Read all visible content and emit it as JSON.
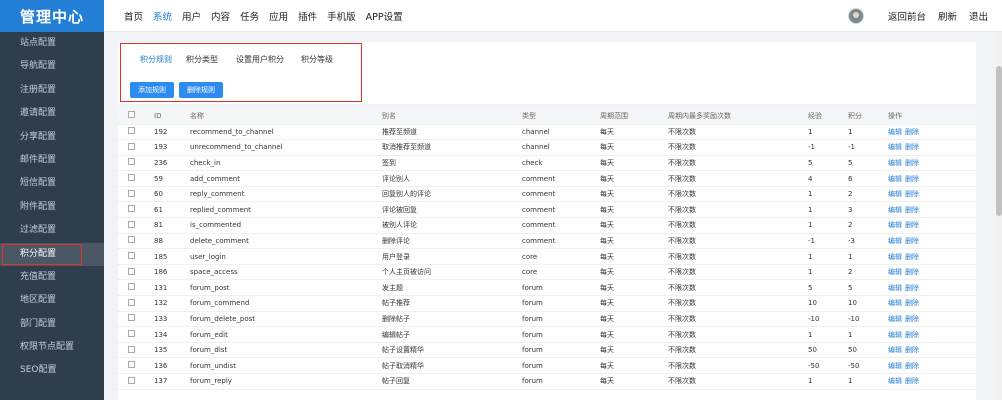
{
  "brand": "管理中心",
  "sidebar": {
    "items": [
      "站点配置",
      "导航配置",
      "注册配置",
      "邀请配置",
      "分享配置",
      "邮件配置",
      "短信配置",
      "附件配置",
      "过滤配置",
      "积分配置",
      "充值配置",
      "地区配置",
      "部门配置",
      "权限节点配置",
      "SEO配置"
    ],
    "active_index": 9
  },
  "topnav": {
    "items": [
      "首页",
      "系统",
      "用户",
      "内容",
      "任务",
      "应用",
      "插件",
      "手机版",
      "APP设置"
    ],
    "active_index": 1
  },
  "topright": [
    "返回前台",
    "刷新",
    "退出"
  ],
  "tabs": [
    "积分规则",
    "积分类型",
    "设置用户积分",
    "积分等级"
  ],
  "buttons": [
    "添加规则",
    "删除规则"
  ],
  "table": {
    "headers": [
      "ID",
      "名称",
      "别名",
      "类型",
      "周期范围",
      "周期内最多奖励次数",
      "经验",
      "积分",
      "操作"
    ],
    "op_labels": [
      "编辑",
      "删除"
    ],
    "rows": [
      [
        "192",
        "recommend_to_channel",
        "推荐至频道",
        "channel",
        "每天",
        "不限次数",
        "1",
        "1"
      ],
      [
        "193",
        "unrecommend_to_channel",
        "取消推荐至频道",
        "channel",
        "每天",
        "不限次数",
        "-1",
        "-1"
      ],
      [
        "236",
        "check_in",
        "签到",
        "check",
        "每天",
        "不限次数",
        "5",
        "5"
      ],
      [
        "59",
        "add_comment",
        "评论别人",
        "comment",
        "每天",
        "不限次数",
        "4",
        "6"
      ],
      [
        "60",
        "reply_comment",
        "回复别人的评论",
        "comment",
        "每天",
        "不限次数",
        "1",
        "2"
      ],
      [
        "61",
        "replied_comment",
        "评论被回复",
        "comment",
        "每天",
        "不限次数",
        "1",
        "3"
      ],
      [
        "81",
        "is_commented",
        "被别人评论",
        "comment",
        "每天",
        "不限次数",
        "1",
        "2"
      ],
      [
        "88",
        "delete_comment",
        "删除评论",
        "comment",
        "每天",
        "不限次数",
        "-1",
        "-3"
      ],
      [
        "185",
        "user_login",
        "用户登录",
        "core",
        "每天",
        "不限次数",
        "1",
        "1"
      ],
      [
        "186",
        "space_access",
        "个人主页被访问",
        "core",
        "每天",
        "不限次数",
        "1",
        "2"
      ],
      [
        "131",
        "forum_post",
        "发主题",
        "forum",
        "每天",
        "不限次数",
        "5",
        "5"
      ],
      [
        "132",
        "forum_commend",
        "帖子推荐",
        "forum",
        "每天",
        "不限次数",
        "10",
        "10"
      ],
      [
        "133",
        "forum_delete_post",
        "删除帖子",
        "forum",
        "每天",
        "不限次数",
        "-10",
        "-10"
      ],
      [
        "134",
        "forum_edit",
        "编辑帖子",
        "forum",
        "每天",
        "不限次数",
        "1",
        "1"
      ],
      [
        "135",
        "forum_dist",
        "帖子设置精华",
        "forum",
        "每天",
        "不限次数",
        "50",
        "50"
      ],
      [
        "136",
        "forum_undist",
        "帖子取消精华",
        "forum",
        "每天",
        "不限次数",
        "-50",
        "-50"
      ],
      [
        "137",
        "forum_reply",
        "帖子回复",
        "forum",
        "每天",
        "不限次数",
        "1",
        "1"
      ]
    ]
  }
}
